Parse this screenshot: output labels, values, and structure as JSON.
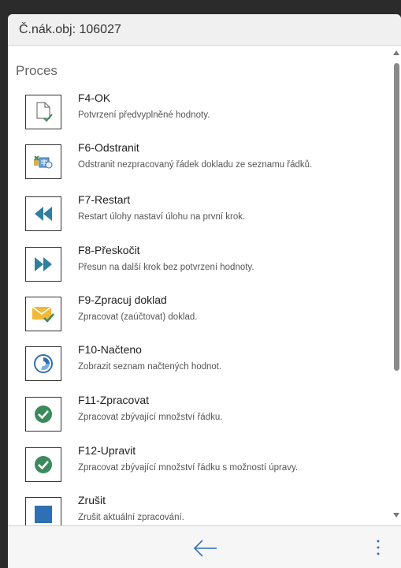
{
  "header": {
    "title": "Č.nák.obj: 106027"
  },
  "section": {
    "title": "Proces"
  },
  "items": [
    {
      "title": "F4-OK",
      "desc": "Potvrzení předvyplněné hodnoty.",
      "icon": "document-check-icon"
    },
    {
      "title": "F6-Odstranit",
      "desc": "Odstranit nezpracovaný řádek dokladu ze seznamu řádků.",
      "icon": "delete-line-icon"
    },
    {
      "title": "F7-Restart",
      "desc": "Restart úlohy nastaví úlohu na první krok.",
      "icon": "rewind-icon"
    },
    {
      "title": "F8-Přeskočit",
      "desc": "Přesun na další krok bez potvrzení hodnoty.",
      "icon": "fast-forward-icon"
    },
    {
      "title": "F9-Zpracuj doklad",
      "desc": "Zpracovat (zaúčtovat) doklad.",
      "icon": "envelope-check-icon"
    },
    {
      "title": "F10-Načteno",
      "desc": "Zobrazit seznam načtených hodnot.",
      "icon": "progress-circle-icon"
    },
    {
      "title": "F11-Zpracovat",
      "desc": "Zpracovat zbývající množství řádku.",
      "icon": "green-check-icon"
    },
    {
      "title": "F12-Upravit",
      "desc": "Zpracovat zbývající množství řádku s možností úpravy.",
      "icon": "green-check-icon"
    },
    {
      "title": "Zrušit",
      "desc": "Zrušit aktuální zpracování.",
      "icon": "stop-square-icon"
    }
  ],
  "colors": {
    "accent_blue": "#2f6fb3",
    "check_green": "#3c8a5c",
    "envelope_yellow": "#f0b93a"
  },
  "footer": {
    "back_icon": "arrow-left-icon",
    "more_icon": "more-vertical-icon"
  }
}
